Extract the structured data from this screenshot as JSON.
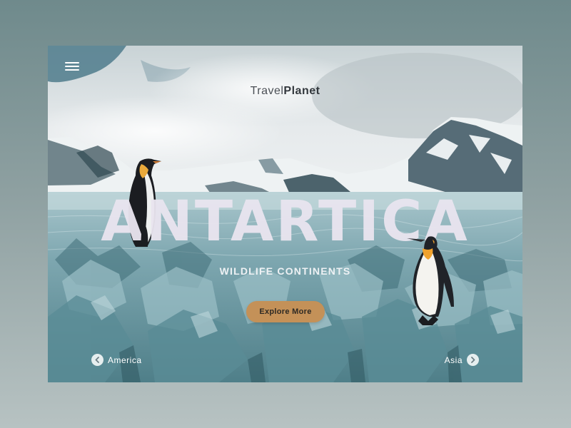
{
  "brand": {
    "part1": "Travel",
    "part2": "Planet"
  },
  "hero": {
    "title": "ANTARTICA",
    "subtitle": "WILDLIFE CONTINENTS",
    "cta_label": "Explore More"
  },
  "navigation": {
    "prev_label": "America",
    "next_label": "Asia"
  },
  "icons": {
    "menu": "hamburger-menu-icon",
    "prev": "chevron-left-circle-icon",
    "next": "chevron-right-circle-icon"
  },
  "colors": {
    "page_bg": "#7f9596",
    "cta_bg": "#c49158",
    "title": "#e8e4ee",
    "ice": "#5f8f98"
  }
}
